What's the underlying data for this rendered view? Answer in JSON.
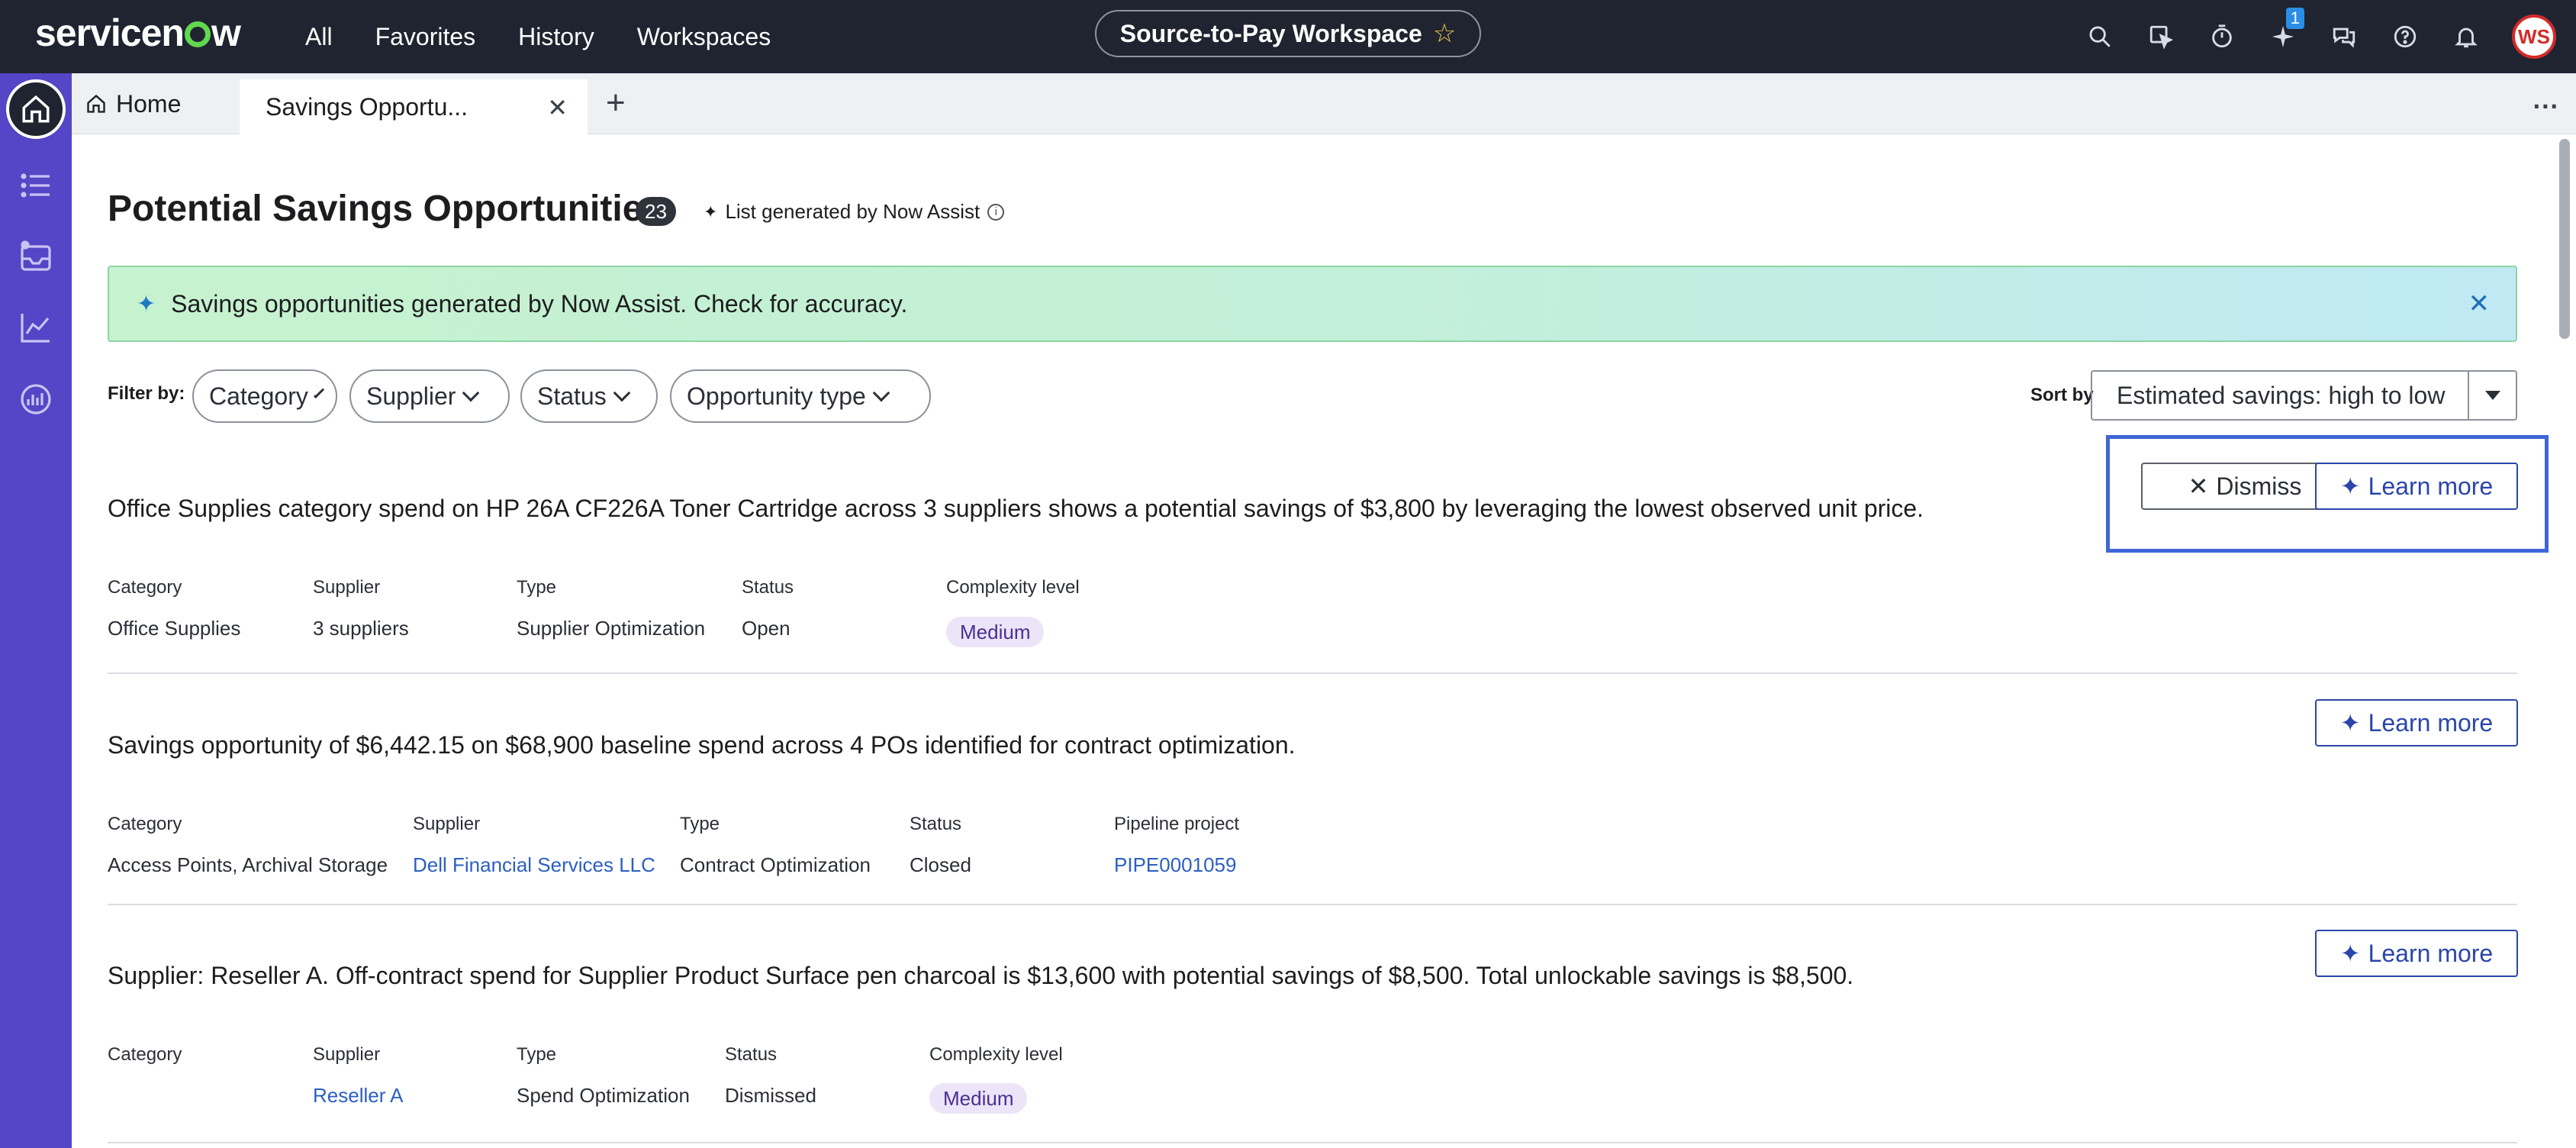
{
  "topnav": {
    "logo": "servicenow",
    "links": [
      "All",
      "Favorites",
      "History",
      "Workspaces"
    ],
    "workspace": "Source-to-Pay Workspace",
    "icons": [
      "search-icon",
      "cursor-icon",
      "timer-icon",
      "sparkle-icon",
      "chat-icon",
      "help-icon",
      "bell-icon"
    ],
    "sparkle_badge": "1",
    "avatar_initials": "WS"
  },
  "tabs": {
    "home_label": "Home",
    "active_label": "Savings Opportu...",
    "add_label": "+",
    "more_label": "..."
  },
  "page": {
    "title": "Potential Savings Opportunities",
    "count": "23",
    "now_assist_note": "List generated by Now Assist",
    "banner_text": "Savings opportunities generated by Now Assist. Check for accuracy.",
    "filter_label": "Filter by:",
    "filters": [
      "Category",
      "Supplier",
      "Status",
      "Opportunity type"
    ],
    "sort_label": "Sort by",
    "sort_value": "Estimated savings: high to low",
    "dismiss_label": "Dismiss",
    "learn_more_label": "Learn more"
  },
  "cards": [
    {
      "description": "Office Supplies category spend on HP 26A CF226A Toner Cartridge across 3 suppliers shows a potential savings of $3,800 by leveraging the lowest observed unit price.",
      "fields": [
        {
          "label": "Category",
          "value": "Office Supplies"
        },
        {
          "label": "Supplier",
          "value": "3 suppliers"
        },
        {
          "label": "Type",
          "value": "Supplier Optimization"
        },
        {
          "label": "Status",
          "value": "Open"
        },
        {
          "label": "Complexity level",
          "value": "Medium"
        }
      ]
    },
    {
      "description": "Savings opportunity of $6,442.15 on $68,900 baseline spend across 4 POs identified for contract optimization.",
      "fields": [
        {
          "label": "Category",
          "value": "Access Points, Archival Storage"
        },
        {
          "label": "Supplier",
          "value": "Dell Financial Services LLC"
        },
        {
          "label": "Type",
          "value": "Contract Optimization"
        },
        {
          "label": "Status",
          "value": "Closed"
        },
        {
          "label": "Pipeline project",
          "value": "PIPE0001059"
        }
      ]
    },
    {
      "description": "Supplier: Reseller A. Off-contract spend for Supplier Product Surface pen charcoal is $13,600 with potential savings of $8,500. Total unlockable savings is $8,500.",
      "fields": [
        {
          "label": "Category",
          "value": ""
        },
        {
          "label": "Supplier",
          "value": "Reseller A"
        },
        {
          "label": "Type",
          "value": "Spend Optimization"
        },
        {
          "label": "Status",
          "value": "Dismissed"
        },
        {
          "label": "Complexity level",
          "value": "Medium"
        }
      ]
    }
  ],
  "colors": {
    "nav_bg": "#1f2430",
    "sidebar_bg": "#5446c6",
    "accent": "#2b46a8",
    "link": "#2b5fc2",
    "highlight": "#3f66d6"
  }
}
